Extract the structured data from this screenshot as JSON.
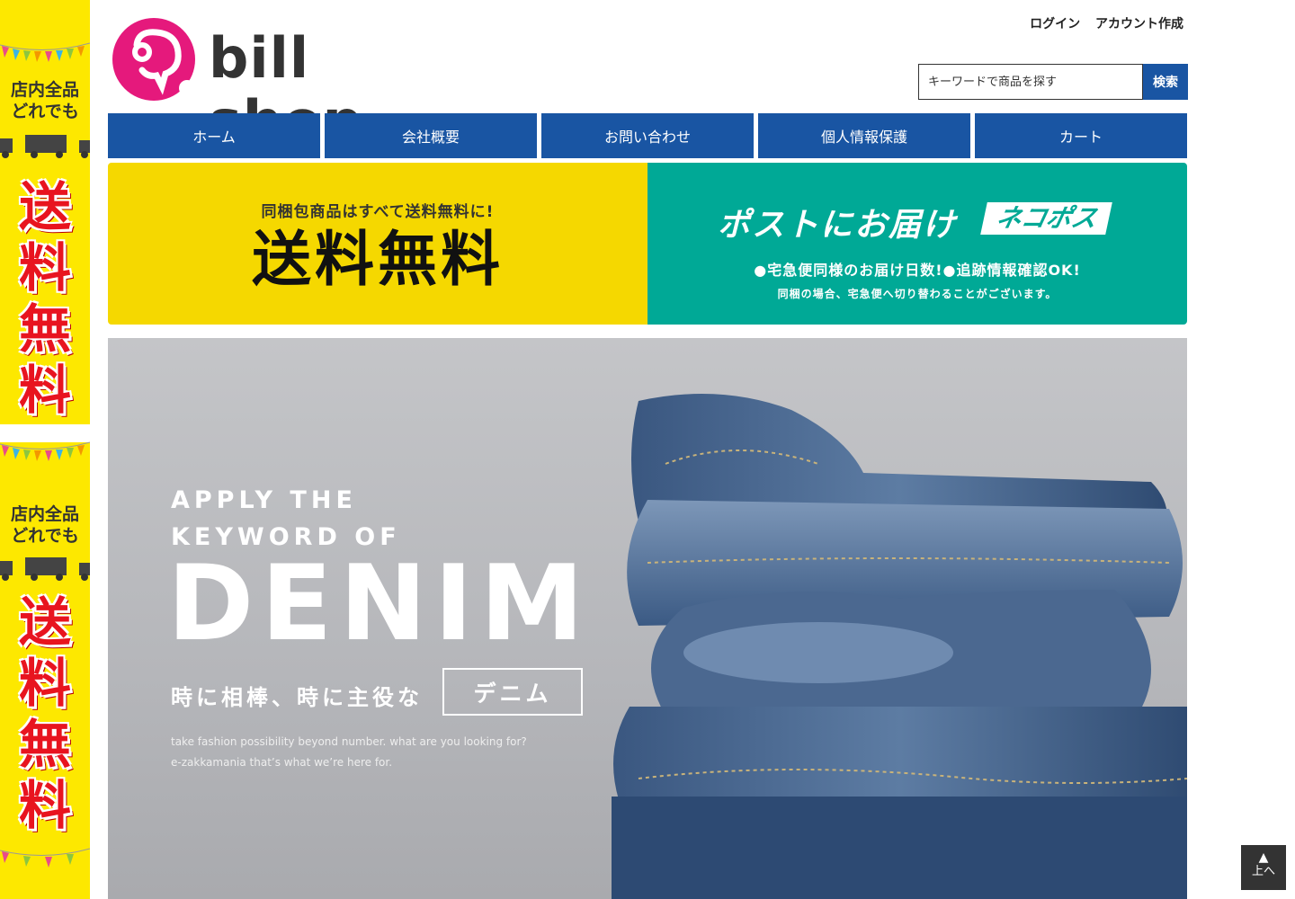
{
  "side_banner": {
    "line1": "店内全品",
    "line2": "どれでも",
    "chars": [
      "送",
      "料",
      "無",
      "料"
    ]
  },
  "header": {
    "logo_text": "bill shop",
    "login": "ログイン",
    "create_account": "アカウント作成",
    "search_placeholder": "キーワードで商品を探す",
    "search_button": "検索"
  },
  "nav": {
    "items": [
      "ホーム",
      "会社概要",
      "お問い合わせ",
      "個人情報保護",
      "カート"
    ]
  },
  "promo_free_shipping": {
    "sub": "同梱包商品はすべて送料無料に!",
    "main": "送料無料"
  },
  "promo_nekopos": {
    "title": "ポストにお届け",
    "badge": "ネコポス",
    "line1": "●宅急便同様のお届け日数!●追跡情報確認OK!",
    "line2": "同梱の場合、宅急便へ切り替わることがございます。"
  },
  "hero": {
    "kicker1": "APPLY THE",
    "kicker2": "KEYWORD OF",
    "title": "DENIM",
    "tagline": "時に相棒、時に主役な",
    "box_label": "デニム",
    "copy1": "take fashion possibility beyond number. what are you looking for?",
    "copy2": "e-zakkamania that’s what we’re here for."
  },
  "to_top": {
    "label": "上へ"
  },
  "colors": {
    "nav_blue": "#1955a3",
    "promo_yellow": "#f5d800",
    "promo_teal": "#00a996",
    "logo_pink": "#e5197c",
    "banner_red": "#e8141f"
  }
}
